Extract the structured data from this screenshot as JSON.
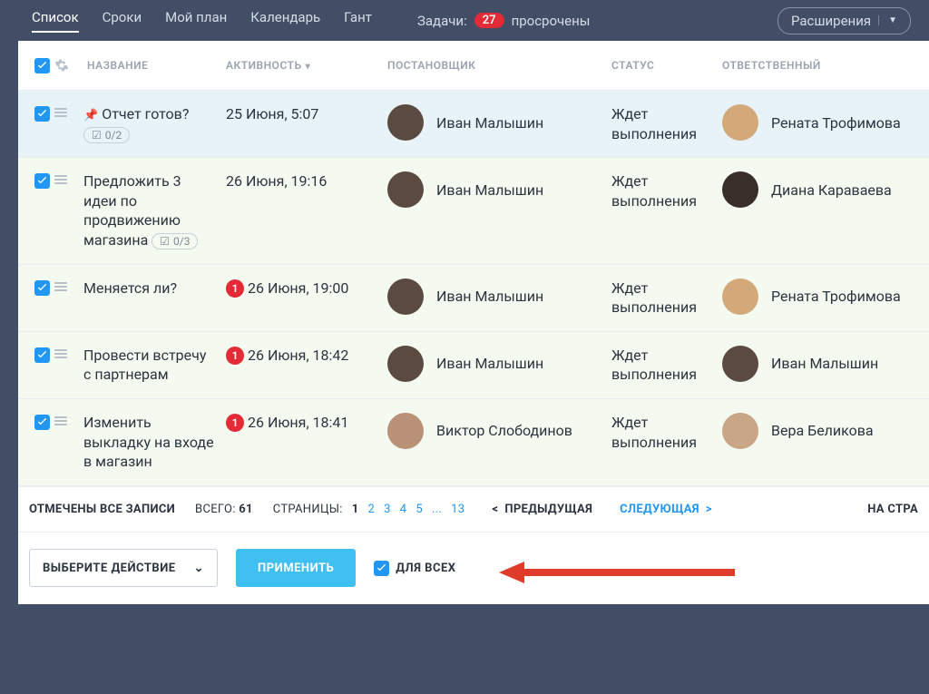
{
  "topbar": {
    "tabs": [
      "Список",
      "Сроки",
      "Мой план",
      "Календарь",
      "Гант"
    ],
    "active_tab": 0,
    "tasks_label": "Задачи:",
    "tasks_count": "27",
    "overdue_label": "просрочены",
    "extensions_label": "Расширения"
  },
  "headers": {
    "title": "НАЗВАНИЕ",
    "activity": "АКТИВНОСТЬ",
    "setter": "ПОСТАНОВЩИК",
    "status": "СТАТУС",
    "responsible": "ОТВЕТСТВЕННЫЙ"
  },
  "rows": [
    {
      "blue": true,
      "pin": true,
      "title": "Отчет готов?",
      "sub": "0/2",
      "activity": "25 Июня, 5:07",
      "badge": "",
      "setter": "Иван Малышин",
      "setter_av": "av1",
      "status": "Ждет выполнения",
      "resp": "Рената Трофимова",
      "resp_av": "av2"
    },
    {
      "title": "Предложить 3 идеи по продвижению магазина",
      "sub": "0/3",
      "activity": "26 Июня, 19:16",
      "badge": "",
      "setter": "Иван Малышин",
      "setter_av": "av1",
      "status": "Ждет выполнения",
      "resp": "Диана Караваева",
      "resp_av": "av3"
    },
    {
      "title": "Меняется ли?",
      "activity": "26 Июня, 19:00",
      "badge": "1",
      "setter": "Иван Малышин",
      "setter_av": "av1",
      "status": "Ждет выполнения",
      "resp": "Рената Трофимова",
      "resp_av": "av2"
    },
    {
      "title": "Провести встречу с партнерам",
      "activity": "26 Июня, 18:42",
      "badge": "1",
      "setter": "Иван Малышин",
      "setter_av": "av1",
      "status": "Ждет выполнения",
      "resp": "Иван Малышин",
      "resp_av": "av1"
    },
    {
      "title": "Изменить выкладку на входе в магазин",
      "activity": "26 Июня, 18:41",
      "badge": "1",
      "setter": "Виктор Слободинов",
      "setter_av": "av4",
      "status": "Ждет выполнения",
      "resp": "Вера Беликова",
      "resp_av": "av5"
    }
  ],
  "footer": {
    "selected_all": "ОТМЕЧЕНЫ ВСЕ ЗАПИСИ",
    "total_label": "ВСЕГО:",
    "total": "61",
    "pages_label": "СТРАНИЦЫ:",
    "pages": [
      "1",
      "2",
      "3",
      "4",
      "5",
      "...",
      "13"
    ],
    "prev": "ПРЕДЫДУЩАЯ",
    "next": "СЛЕДУЮЩАЯ",
    "onpage": "НА СТРА",
    "select_action": "ВЫБЕРИТЕ ДЕЙСТВИЕ",
    "apply": "ПРИМЕНИТЬ",
    "for_all": "ДЛЯ ВСЕХ"
  }
}
